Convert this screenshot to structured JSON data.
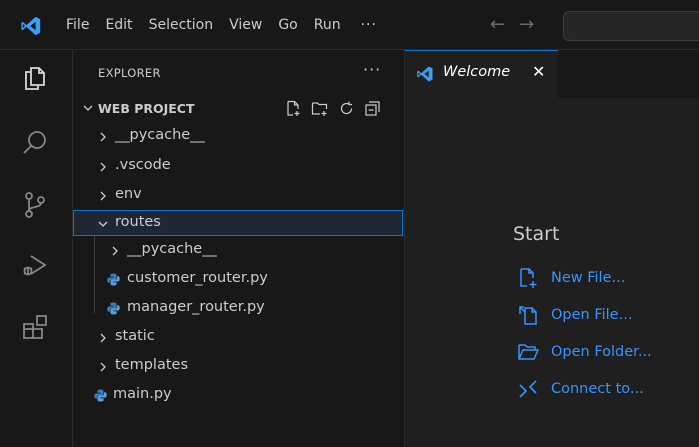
{
  "titlebar": {
    "menu": [
      "File",
      "Edit",
      "Selection",
      "View",
      "Go",
      "Run"
    ],
    "more": "···",
    "back_arrow": "←",
    "forward_arrow": "→"
  },
  "activity_bar": {
    "icons": [
      "explorer-icon",
      "search-icon",
      "source-control-icon",
      "run-debug-icon",
      "extensions-icon"
    ]
  },
  "sidebar": {
    "title": "EXPLORER",
    "more": "···",
    "section_label": "WEB PROJECT",
    "section_actions": [
      "new-file-icon",
      "new-folder-icon",
      "refresh-icon",
      "collapse-all-icon"
    ],
    "tree": [
      {
        "name": "__pycache__",
        "type": "folder",
        "expanded": false,
        "depth": 0
      },
      {
        "name": ".vscode",
        "type": "folder",
        "expanded": false,
        "depth": 0
      },
      {
        "name": "env",
        "type": "folder",
        "expanded": false,
        "depth": 0
      },
      {
        "name": "routes",
        "type": "folder",
        "expanded": true,
        "depth": 0,
        "selected": true
      },
      {
        "name": "__pycache__",
        "type": "folder",
        "expanded": false,
        "depth": 1
      },
      {
        "name": "customer_router.py",
        "type": "python",
        "depth": 1
      },
      {
        "name": "manager_router.py",
        "type": "python",
        "depth": 1
      },
      {
        "name": "static",
        "type": "folder",
        "expanded": false,
        "depth": 0
      },
      {
        "name": "templates",
        "type": "folder",
        "expanded": false,
        "depth": 0
      },
      {
        "name": "main.py",
        "type": "python",
        "depth": 0
      }
    ]
  },
  "tabs": [
    {
      "label": "Welcome",
      "active": true,
      "close": "✕"
    }
  ],
  "welcome": {
    "start_title": "Start",
    "items": [
      {
        "label": "New File...",
        "icon": "new-file-icon"
      },
      {
        "label": "Open File...",
        "icon": "open-file-icon"
      },
      {
        "label": "Open Folder...",
        "icon": "open-folder-icon"
      },
      {
        "label": "Connect to...",
        "icon": "remote-connect-icon"
      }
    ]
  },
  "colors": {
    "accent": "#0078d4",
    "link": "#3794ff",
    "logo": "#3c9ef5",
    "python": "#3d7ab8"
  }
}
